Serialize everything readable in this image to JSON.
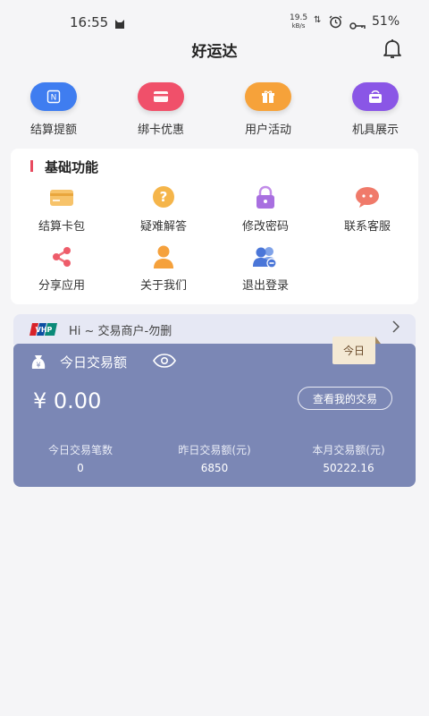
{
  "status": {
    "time": "16:55",
    "speed": "19.5",
    "speed_unit": "kB/s",
    "battery": "51%"
  },
  "header": {
    "title": "好运达"
  },
  "quick_actions": [
    {
      "label": "结算提额",
      "color": "#3f7df0",
      "icon": "n-card-icon"
    },
    {
      "label": "绑卡优惠",
      "color": "#f0506a",
      "icon": "card-icon"
    },
    {
      "label": "用户活动",
      "color": "#f6a23a",
      "icon": "gift-icon"
    },
    {
      "label": "机具展示",
      "color": "#8a56e6",
      "icon": "pos-terminal-icon"
    }
  ],
  "basic": {
    "title": "基础功能",
    "items": [
      {
        "label": "结算卡包"
      },
      {
        "label": "疑难解答"
      },
      {
        "label": "修改密码"
      },
      {
        "label": "联系客服"
      },
      {
        "label": "分享应用"
      },
      {
        "label": "关于我们"
      },
      {
        "label": "退出登录"
      }
    ]
  },
  "merchant": {
    "greeting": "Hi ~ 交易商户-勿删"
  },
  "transactions": {
    "title": "今日交易额",
    "badge": "今日",
    "amount": "¥  0.00",
    "view_button": "查看我的交易",
    "stats": [
      {
        "label": "今日交易笔数",
        "value": "0"
      },
      {
        "label": "昨日交易额(元)",
        "value": "6850"
      },
      {
        "label": "本月交易额(元)",
        "value": "50222.16"
      }
    ]
  }
}
